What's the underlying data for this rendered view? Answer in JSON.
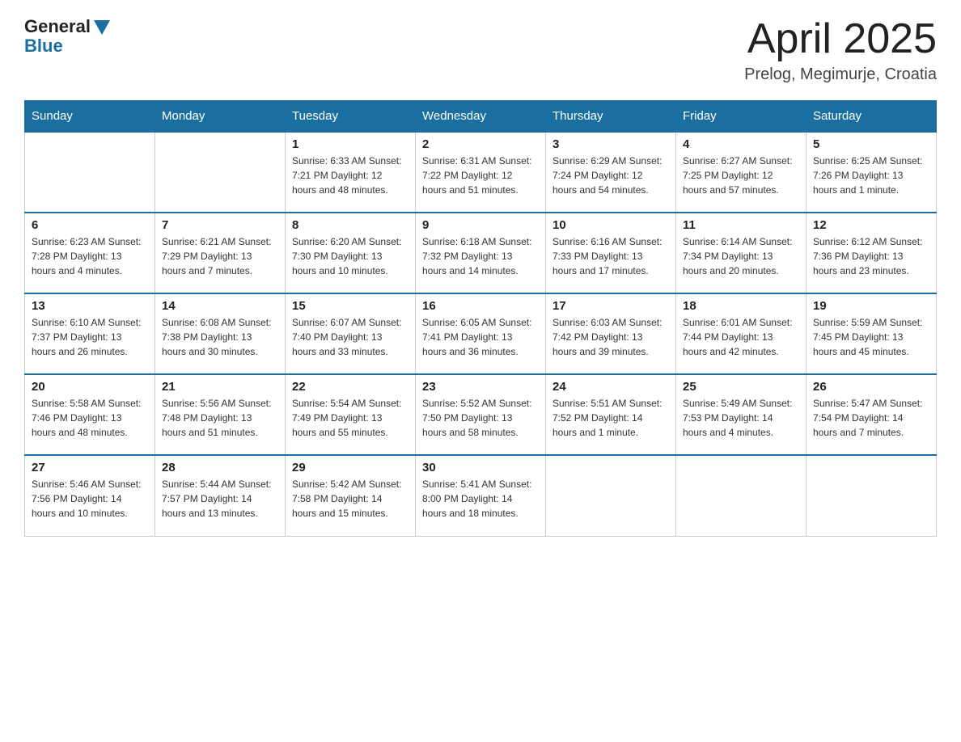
{
  "header": {
    "logo_general": "General",
    "logo_blue": "Blue",
    "title": "April 2025",
    "location": "Prelog, Megimurje, Croatia"
  },
  "columns": [
    "Sunday",
    "Monday",
    "Tuesday",
    "Wednesday",
    "Thursday",
    "Friday",
    "Saturday"
  ],
  "weeks": [
    [
      {
        "day": "",
        "info": ""
      },
      {
        "day": "",
        "info": ""
      },
      {
        "day": "1",
        "info": "Sunrise: 6:33 AM\nSunset: 7:21 PM\nDaylight: 12 hours\nand 48 minutes."
      },
      {
        "day": "2",
        "info": "Sunrise: 6:31 AM\nSunset: 7:22 PM\nDaylight: 12 hours\nand 51 minutes."
      },
      {
        "day": "3",
        "info": "Sunrise: 6:29 AM\nSunset: 7:24 PM\nDaylight: 12 hours\nand 54 minutes."
      },
      {
        "day": "4",
        "info": "Sunrise: 6:27 AM\nSunset: 7:25 PM\nDaylight: 12 hours\nand 57 minutes."
      },
      {
        "day": "5",
        "info": "Sunrise: 6:25 AM\nSunset: 7:26 PM\nDaylight: 13 hours\nand 1 minute."
      }
    ],
    [
      {
        "day": "6",
        "info": "Sunrise: 6:23 AM\nSunset: 7:28 PM\nDaylight: 13 hours\nand 4 minutes."
      },
      {
        "day": "7",
        "info": "Sunrise: 6:21 AM\nSunset: 7:29 PM\nDaylight: 13 hours\nand 7 minutes."
      },
      {
        "day": "8",
        "info": "Sunrise: 6:20 AM\nSunset: 7:30 PM\nDaylight: 13 hours\nand 10 minutes."
      },
      {
        "day": "9",
        "info": "Sunrise: 6:18 AM\nSunset: 7:32 PM\nDaylight: 13 hours\nand 14 minutes."
      },
      {
        "day": "10",
        "info": "Sunrise: 6:16 AM\nSunset: 7:33 PM\nDaylight: 13 hours\nand 17 minutes."
      },
      {
        "day": "11",
        "info": "Sunrise: 6:14 AM\nSunset: 7:34 PM\nDaylight: 13 hours\nand 20 minutes."
      },
      {
        "day": "12",
        "info": "Sunrise: 6:12 AM\nSunset: 7:36 PM\nDaylight: 13 hours\nand 23 minutes."
      }
    ],
    [
      {
        "day": "13",
        "info": "Sunrise: 6:10 AM\nSunset: 7:37 PM\nDaylight: 13 hours\nand 26 minutes."
      },
      {
        "day": "14",
        "info": "Sunrise: 6:08 AM\nSunset: 7:38 PM\nDaylight: 13 hours\nand 30 minutes."
      },
      {
        "day": "15",
        "info": "Sunrise: 6:07 AM\nSunset: 7:40 PM\nDaylight: 13 hours\nand 33 minutes."
      },
      {
        "day": "16",
        "info": "Sunrise: 6:05 AM\nSunset: 7:41 PM\nDaylight: 13 hours\nand 36 minutes."
      },
      {
        "day": "17",
        "info": "Sunrise: 6:03 AM\nSunset: 7:42 PM\nDaylight: 13 hours\nand 39 minutes."
      },
      {
        "day": "18",
        "info": "Sunrise: 6:01 AM\nSunset: 7:44 PM\nDaylight: 13 hours\nand 42 minutes."
      },
      {
        "day": "19",
        "info": "Sunrise: 5:59 AM\nSunset: 7:45 PM\nDaylight: 13 hours\nand 45 minutes."
      }
    ],
    [
      {
        "day": "20",
        "info": "Sunrise: 5:58 AM\nSunset: 7:46 PM\nDaylight: 13 hours\nand 48 minutes."
      },
      {
        "day": "21",
        "info": "Sunrise: 5:56 AM\nSunset: 7:48 PM\nDaylight: 13 hours\nand 51 minutes."
      },
      {
        "day": "22",
        "info": "Sunrise: 5:54 AM\nSunset: 7:49 PM\nDaylight: 13 hours\nand 55 minutes."
      },
      {
        "day": "23",
        "info": "Sunrise: 5:52 AM\nSunset: 7:50 PM\nDaylight: 13 hours\nand 58 minutes."
      },
      {
        "day": "24",
        "info": "Sunrise: 5:51 AM\nSunset: 7:52 PM\nDaylight: 14 hours\nand 1 minute."
      },
      {
        "day": "25",
        "info": "Sunrise: 5:49 AM\nSunset: 7:53 PM\nDaylight: 14 hours\nand 4 minutes."
      },
      {
        "day": "26",
        "info": "Sunrise: 5:47 AM\nSunset: 7:54 PM\nDaylight: 14 hours\nand 7 minutes."
      }
    ],
    [
      {
        "day": "27",
        "info": "Sunrise: 5:46 AM\nSunset: 7:56 PM\nDaylight: 14 hours\nand 10 minutes."
      },
      {
        "day": "28",
        "info": "Sunrise: 5:44 AM\nSunset: 7:57 PM\nDaylight: 14 hours\nand 13 minutes."
      },
      {
        "day": "29",
        "info": "Sunrise: 5:42 AM\nSunset: 7:58 PM\nDaylight: 14 hours\nand 15 minutes."
      },
      {
        "day": "30",
        "info": "Sunrise: 5:41 AM\nSunset: 8:00 PM\nDaylight: 14 hours\nand 18 minutes."
      },
      {
        "day": "",
        "info": ""
      },
      {
        "day": "",
        "info": ""
      },
      {
        "day": "",
        "info": ""
      }
    ]
  ]
}
